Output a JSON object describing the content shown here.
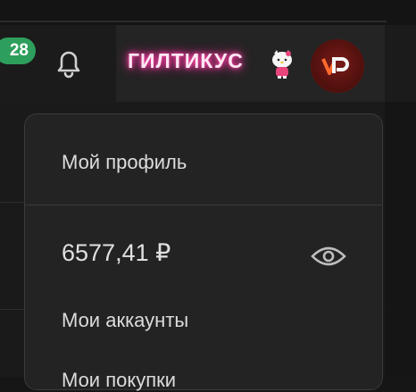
{
  "header": {
    "notification_count": "28",
    "username": "ГИЛТИКУС",
    "bell_icon": "bell-icon",
    "avatar_icon": "vp-logo-avatar",
    "sticker_icon": "hello-kitty-sticker"
  },
  "dropdown": {
    "profile_label": "Мой профиль",
    "balance": "6577,41 ₽",
    "balance_toggle_icon": "eye-icon",
    "accounts_label": "Мои аккаунты",
    "purchases_label": "Мои покупки"
  },
  "colors": {
    "badge": "#2e9e5c",
    "username_glow": "#ff3fa6",
    "avatar_bg": "#5a130f",
    "menu_bg": "#232323"
  }
}
